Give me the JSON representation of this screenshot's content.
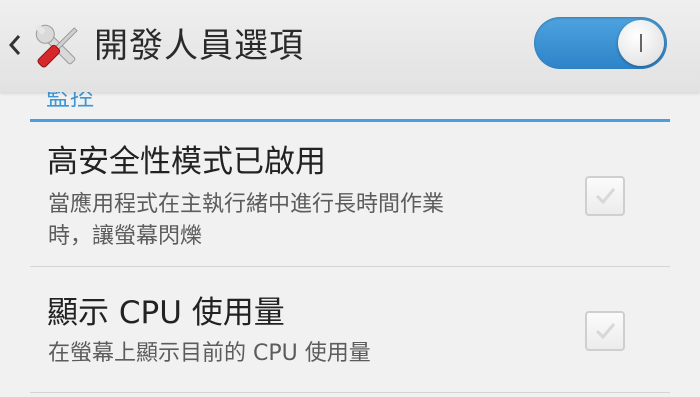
{
  "action_bar": {
    "title": "開發人員選項",
    "back_icon": "chevron-left-icon",
    "app_icon": "tools-icon",
    "master_switch": {
      "state": "on",
      "color": "#3a8fd3"
    }
  },
  "section": {
    "header": "監控",
    "accent_color": "#4b9fdc"
  },
  "preferences": [
    {
      "title": "高安全性模式已啟用",
      "summary_line1": "當應用程式在主執行緒中進行長時間作業",
      "summary_line2": "時，讓螢幕閃爍",
      "checked": false
    },
    {
      "title": "顯示 CPU 使用量",
      "summary": "在螢幕上顯示目前的 CPU 使用量",
      "checked": false
    }
  ]
}
